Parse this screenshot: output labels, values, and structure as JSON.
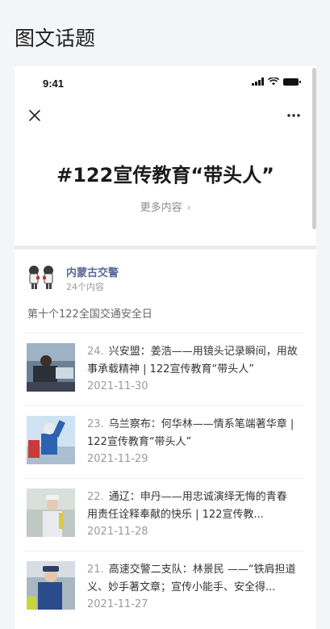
{
  "page": {
    "title": "图文话题"
  },
  "status_bar": {
    "time": "9:41"
  },
  "topic": {
    "title": "#122宣传教育“带头人”",
    "more_label": "更多内容"
  },
  "author": {
    "name": "内蒙古交警",
    "count": "24个内容"
  },
  "description": "第十个122全国交通安全日",
  "articles": [
    {
      "num": "24.",
      "title": "兴安盟：姜浩——用镜头记录瞬间，用故事承载精神 | 122宣传教育“带头人”",
      "date": "2021-11-30"
    },
    {
      "num": "23.",
      "title": "乌兰察布：何华林——情系笔端著华章 | 122宣传教育“带头人”",
      "date": "2021-11-29"
    },
    {
      "num": "22.",
      "title": "通辽：申丹——用忠诚演绎无悔的青春 用责任诠释奉献的快乐 | 122宣传教...",
      "date": "2021-11-28"
    },
    {
      "num": "21.",
      "title": "高速交警二支队：林景民 ——“铁肩担道义、妙手著文章；宣传小能手、安全得...",
      "date": "2021-11-27"
    }
  ],
  "colors": {
    "author_link": "#576b95",
    "muted": "#9b9b9b",
    "background": "#f4f5f7"
  }
}
